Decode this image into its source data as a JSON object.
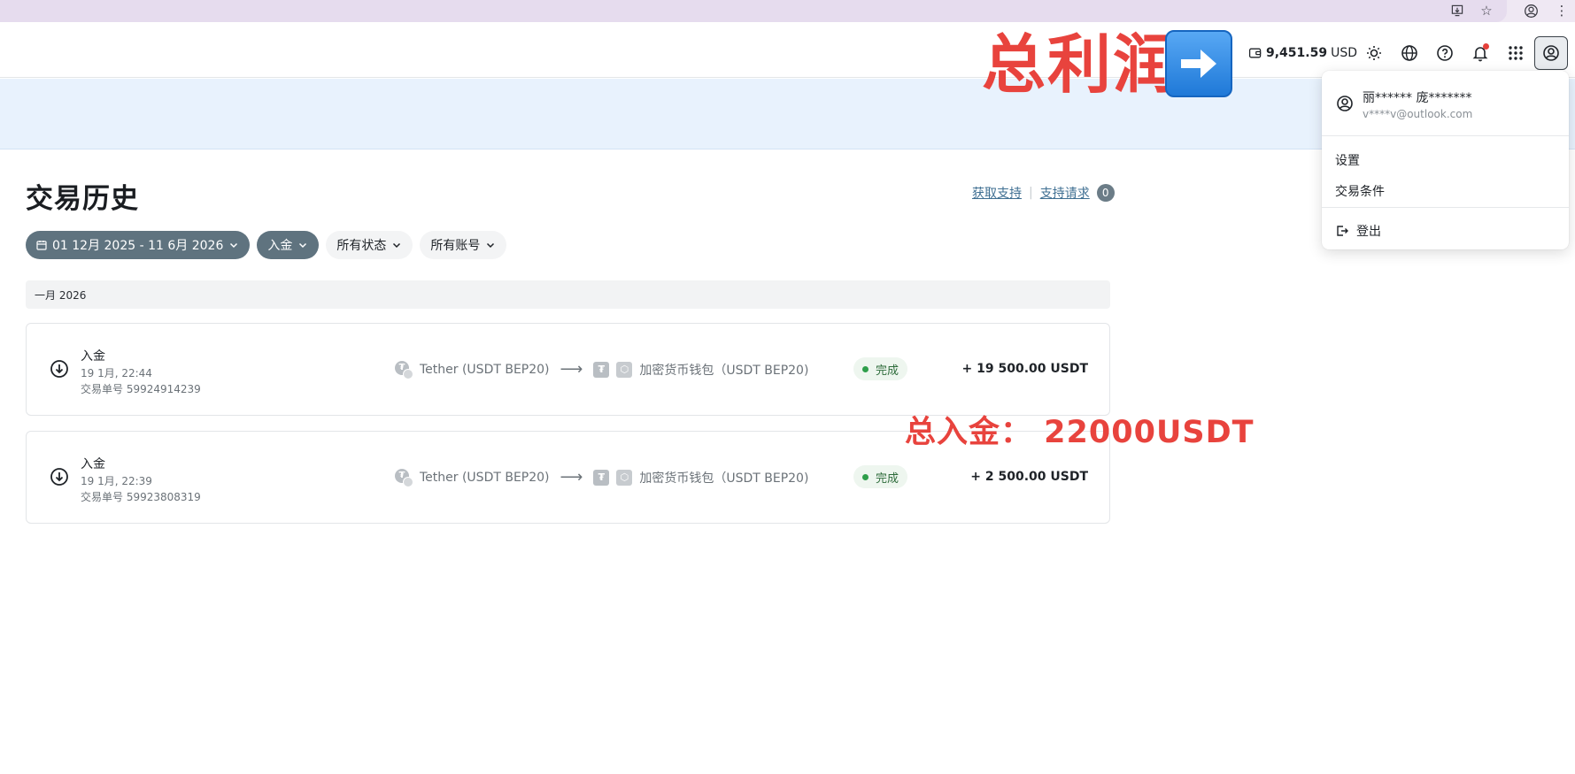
{
  "browser": {
    "icons": [
      "install-icon",
      "star-icon",
      "browser-profile-icon",
      "more-vert-icon"
    ]
  },
  "header": {
    "wallet_amount": "9,451.59",
    "wallet_currency": "USD",
    "icons": [
      "wallet-icon",
      "sun-icon",
      "globe-icon",
      "help-icon",
      "bell-icon",
      "apps-grid-icon",
      "account-icon"
    ]
  },
  "page": {
    "title": "交易历史",
    "support_link": "获取支持",
    "support_sep": "|",
    "requests_link": "支持请求",
    "requests_count": "0"
  },
  "filters": {
    "date_range": "01 12月 2025 - 11 6月 2026",
    "type": "入金",
    "status": "所有状态",
    "account": "所有账号"
  },
  "month_header": "一月 2026",
  "transactions": [
    {
      "type": "入金",
      "date": "19 1月, 22:44",
      "id": "交易单号 59924914239",
      "from": "Tether (USDT BEP20)",
      "to": "加密货币钱包（USDT BEP20)",
      "status": "完成",
      "amount": "+ 19 500.00 USDT"
    },
    {
      "type": "入金",
      "date": "19 1月, 22:39",
      "id": "交易单号 59923808319",
      "from": "Tether (USDT BEP20)",
      "to": "加密货币钱包（USDT BEP20)",
      "status": "完成",
      "amount": "+ 2 500.00 USDT"
    }
  ],
  "menu": {
    "user_name": "丽****** 庞*******",
    "user_email": "v****v@outlook.com",
    "settings": "设置",
    "terms": "交易条件",
    "logout": "登出"
  },
  "annotations": {
    "total_profit": "总利润",
    "total_deposit": "总入金： 22000USDT"
  },
  "colors": {
    "accent_chip": "#5f737f",
    "banner": "#e8f2fd",
    "annotation_red": "#e8433d",
    "status_green": "#2e9e4a",
    "link": "#3f6f92"
  }
}
